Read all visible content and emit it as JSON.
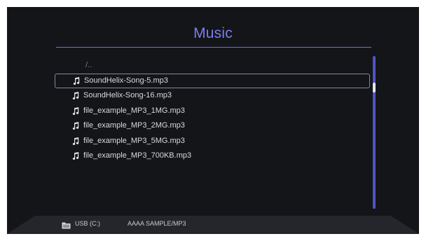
{
  "header": {
    "title": "Music"
  },
  "browser": {
    "parent_entry": "/..",
    "files": [
      {
        "name": "SoundHelix-Song-5.mp3",
        "icon": "music-note-icon",
        "selected": true
      },
      {
        "name": "SoundHelix-Song-16.mp3",
        "icon": "music-note-icon",
        "selected": false
      },
      {
        "name": "file_example_MP3_1MG.mp3",
        "icon": "music-note-icon",
        "selected": false
      },
      {
        "name": "file_example_MP3_2MG.mp3",
        "icon": "music-note-icon",
        "selected": false
      },
      {
        "name": "file_example_MP3_5MG.mp3",
        "icon": "music-note-icon",
        "selected": false
      },
      {
        "name": "file_example_MP3_700KB.mp3",
        "icon": "music-note-icon",
        "selected": false
      }
    ]
  },
  "footer": {
    "drive_icon": "folder-icon",
    "drive": "USB (C:)",
    "path": "AAAA SAMPLE/MP3"
  },
  "colors": {
    "background": "#141519",
    "accent": "#7b7df0",
    "scrollbar": "#5253c7",
    "text": "#d9dadf"
  }
}
